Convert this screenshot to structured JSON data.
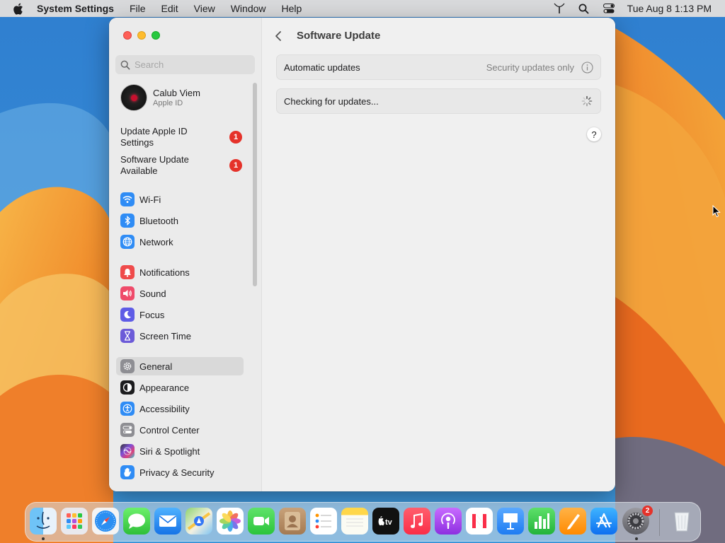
{
  "menubar": {
    "app_name": "System Settings",
    "menus": [
      "File",
      "Edit",
      "View",
      "Window",
      "Help"
    ],
    "clock": "Tue Aug 8  1:13 PM",
    "status_icons": [
      "antenna-icon",
      "search-icon",
      "control-center-icon"
    ]
  },
  "sidebar": {
    "search_placeholder": "Search",
    "account": {
      "name": "Calub Viem",
      "subtitle": "Apple ID"
    },
    "notices": [
      {
        "label": "Update Apple ID Settings",
        "badge": "1"
      },
      {
        "label": "Software Update Available",
        "badge": "1"
      }
    ],
    "items": [
      {
        "label": "Wi-Fi",
        "icon": "wifi-icon",
        "color": "#2f8cf5"
      },
      {
        "label": "Bluetooth",
        "icon": "bluetooth-icon",
        "color": "#2f8cf5"
      },
      {
        "label": "Network",
        "icon": "globe-icon",
        "color": "#2f8cf5"
      },
      {
        "label": "Notifications",
        "icon": "bell-icon",
        "color": "#ef4b4b"
      },
      {
        "label": "Sound",
        "icon": "speaker-icon",
        "color": "#ef4b6a"
      },
      {
        "label": "Focus",
        "icon": "moon-icon",
        "color": "#5e5ce6"
      },
      {
        "label": "Screen Time",
        "icon": "hourglass-icon",
        "color": "#6c5bd8"
      },
      {
        "label": "General",
        "icon": "gear-icon",
        "color": "#8e8e93"
      },
      {
        "label": "Appearance",
        "icon": "appearance-icon",
        "color": "#1d1d1f"
      },
      {
        "label": "Accessibility",
        "icon": "accessibility-icon",
        "color": "#2f8cf5"
      },
      {
        "label": "Control Center",
        "icon": "toggles-icon",
        "color": "#8e8e93"
      },
      {
        "label": "Siri & Spotlight",
        "icon": "siri-icon",
        "color": "#7d4fd8"
      },
      {
        "label": "Privacy & Security",
        "icon": "hand-icon",
        "color": "#2f8cf5"
      }
    ],
    "selected": "General"
  },
  "content": {
    "title": "Software Update",
    "automatic_updates": {
      "label": "Automatic updates",
      "value": "Security updates only"
    },
    "checking": {
      "label": "Checking for updates..."
    },
    "help_label": "?"
  },
  "dock": {
    "apps": [
      {
        "name": "Finder",
        "icon": "finder-icon"
      },
      {
        "name": "Launchpad",
        "icon": "launchpad-icon"
      },
      {
        "name": "Safari",
        "icon": "safari-icon"
      },
      {
        "name": "Messages",
        "icon": "messages-icon"
      },
      {
        "name": "Mail",
        "icon": "mail-icon"
      },
      {
        "name": "Maps",
        "icon": "maps-icon"
      },
      {
        "name": "Photos",
        "icon": "photos-icon"
      },
      {
        "name": "FaceTime",
        "icon": "facetime-icon"
      },
      {
        "name": "Contacts",
        "icon": "contacts-icon"
      },
      {
        "name": "Reminders",
        "icon": "reminders-icon"
      },
      {
        "name": "Notes",
        "icon": "notes-icon"
      },
      {
        "name": "TV",
        "icon": "tv-icon",
        "label": "tv"
      },
      {
        "name": "Music",
        "icon": "music-icon"
      },
      {
        "name": "Podcasts",
        "icon": "podcasts-icon"
      },
      {
        "name": "News",
        "icon": "news-icon"
      },
      {
        "name": "Keynote",
        "icon": "keynote-icon"
      },
      {
        "name": "Numbers",
        "icon": "numbers-icon"
      },
      {
        "name": "Pages",
        "icon": "pages-icon"
      },
      {
        "name": "App Store",
        "icon": "app-store-icon"
      },
      {
        "name": "System Settings",
        "icon": "system-settings-icon",
        "badge": "2"
      },
      {
        "name": "Trash",
        "icon": "trash-icon"
      }
    ]
  }
}
